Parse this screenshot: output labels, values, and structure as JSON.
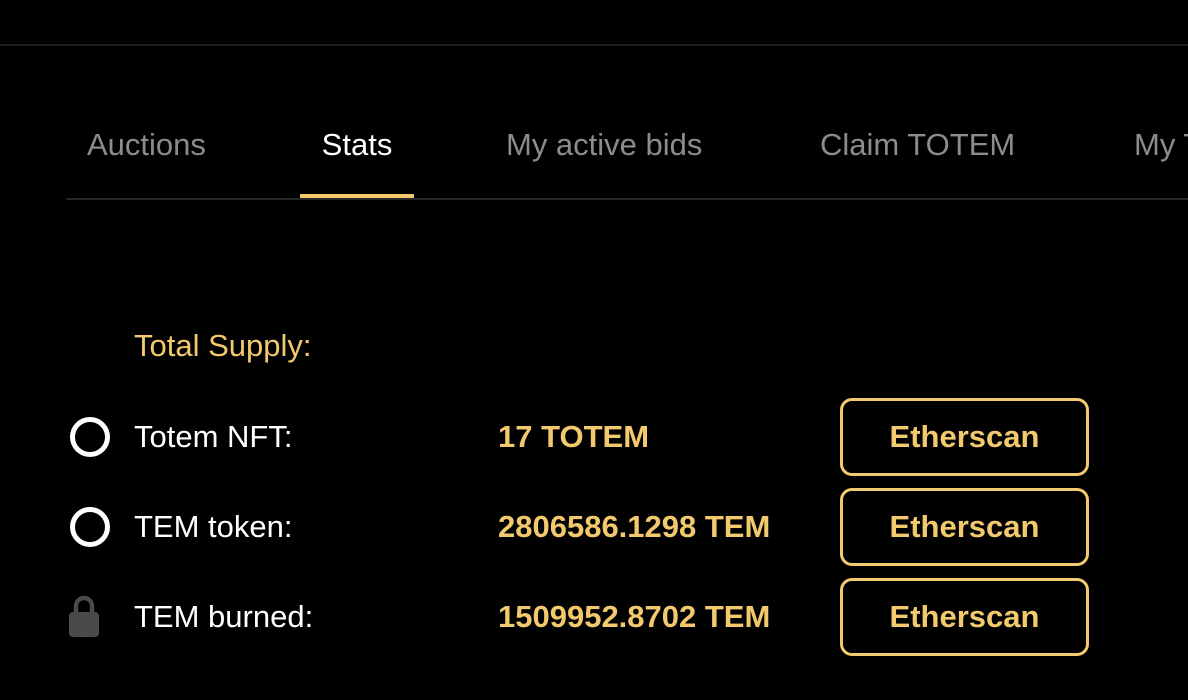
{
  "tabs": [
    {
      "label": "Auctions",
      "active": false
    },
    {
      "label": "Stats",
      "active": true
    },
    {
      "label": "My active bids",
      "active": false
    },
    {
      "label": "Claim TOTEM",
      "active": false
    },
    {
      "label": "My T",
      "active": false
    }
  ],
  "stats": {
    "section_title": "Total Supply:",
    "rows": [
      {
        "icon": "circle-icon",
        "label": "Totem NFT:",
        "value": "17 TOTEM",
        "button_label": "Etherscan"
      },
      {
        "icon": "circle-icon",
        "label": "TEM token:",
        "value": "2806586.1298 TEM",
        "button_label": "Etherscan"
      },
      {
        "icon": "lock-icon",
        "label": "TEM burned:",
        "value": "1509952.8702 TEM",
        "button_label": "Etherscan"
      }
    ]
  },
  "colors": {
    "background": "#000000",
    "accent": "#f3c96d",
    "tab_inactive": "#8c8c8c",
    "text": "#ffffff",
    "lock_icon": "#4a4a4a"
  }
}
